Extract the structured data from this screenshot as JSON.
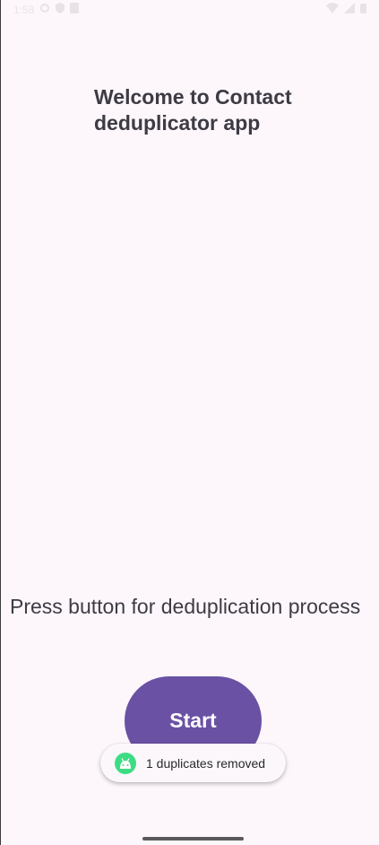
{
  "status_bar": {
    "time": "1:58",
    "left_icons": [
      "settings-icon",
      "shield-icon",
      "sim-icon"
    ],
    "right_icons": [
      "wifi-icon",
      "signal-icon",
      "battery-icon"
    ]
  },
  "main": {
    "title": "Welcome to Contact deduplicator app",
    "prompt": "Press button for deduplication process",
    "start_button_label": "Start"
  },
  "toast": {
    "icon": "android-icon",
    "message": "1 duplicates removed"
  },
  "colors": {
    "background": "#fdf7fc",
    "accent": "#6a51a4",
    "text": "#3e3b44",
    "android_green": "#3ddc84"
  }
}
